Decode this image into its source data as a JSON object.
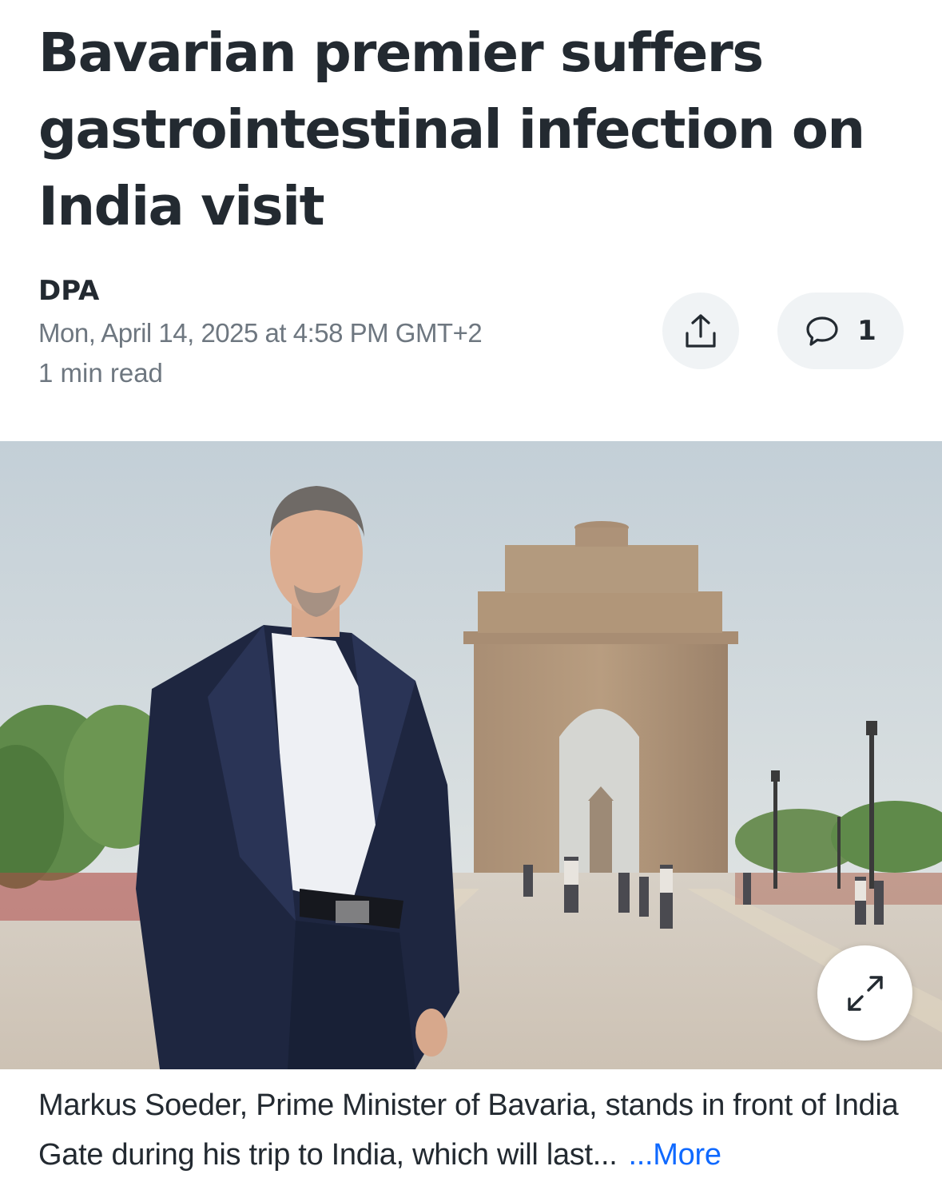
{
  "article": {
    "headline": "Bavarian premier suffers gastrointestinal infection on India visit",
    "source": "DPA",
    "date": "Mon, April 14, 2025 at 4:58 PM GMT+2",
    "read_time": "1 min read"
  },
  "actions": {
    "share_icon": "share-upload-icon",
    "comment_icon": "comment-bubble-icon",
    "comment_count": "1"
  },
  "photo": {
    "expand_icon": "expand-arrows-icon"
  },
  "caption": {
    "text": "Markus Soeder, Prime Minister of Bavaria, stands in front of India Gate during his trip to India, which will last...",
    "more_label": "...More"
  },
  "colors": {
    "link": "#0f69ff",
    "text": "#232a31",
    "meta": "#6e7780",
    "button_bg": "#f0f3f5"
  }
}
